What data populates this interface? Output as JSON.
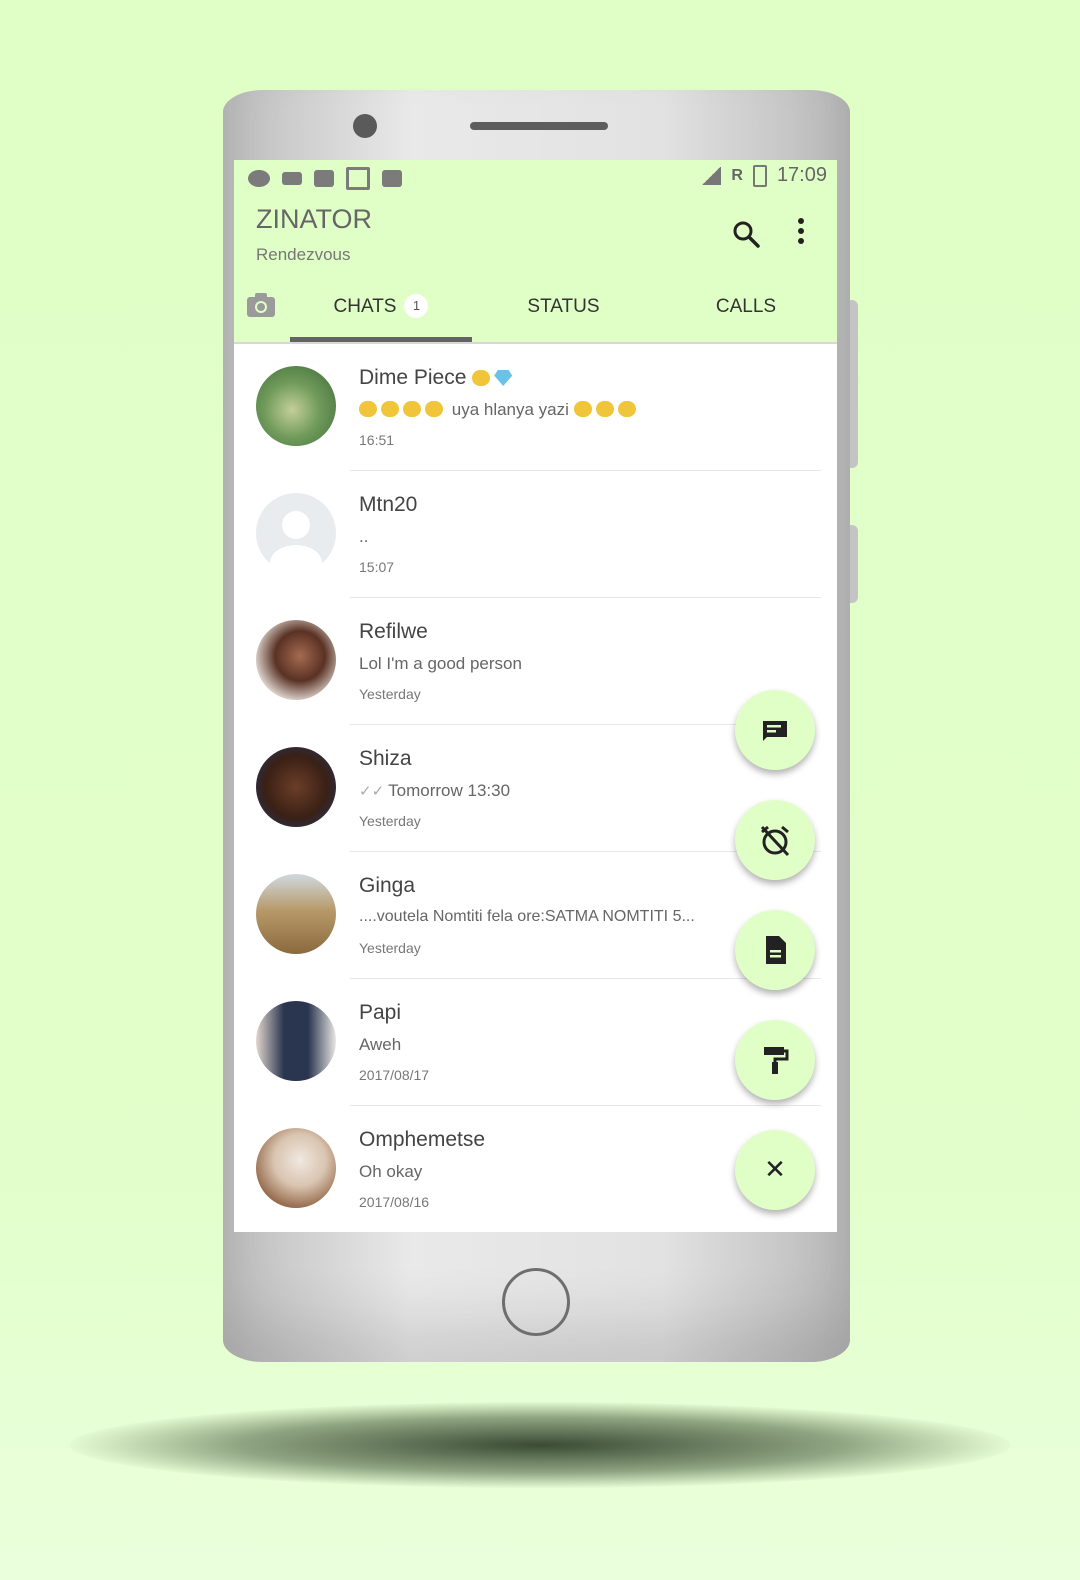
{
  "status_bar": {
    "time": "17:09",
    "carrier_letter": "R"
  },
  "header": {
    "title": "ZINATOR",
    "subtitle": "Rendezvous",
    "search_icon": "search-icon",
    "menu_icon": "more-vert-icon"
  },
  "tabs": [
    {
      "label": "CHATS",
      "badge": "1",
      "active": true
    },
    {
      "label": "STATUS"
    },
    {
      "label": "CALLS"
    }
  ],
  "chats": [
    {
      "name": "Dime Piece",
      "message": "uya hlanya yazi",
      "time": "16:51"
    },
    {
      "name": "Mtn20",
      "message": "..",
      "time": "15:07"
    },
    {
      "name": "Refilwe",
      "message": "Lol I'm a good person",
      "time": "Yesterday"
    },
    {
      "name": "Shiza",
      "message": "Tomorrow 13:30",
      "time": "Yesterday"
    },
    {
      "name": "Ginga",
      "message": "....voutela Nomtiti fela ore:SATMA NOMTITI  5...",
      "time": "Yesterday"
    },
    {
      "name": "Papi",
      "message": "Aweh",
      "time": "2017/08/17"
    },
    {
      "name": "Omphemetse",
      "message": "Oh okay",
      "time": "2017/08/16"
    }
  ],
  "fabs": [
    {
      "icon": "message-icon"
    },
    {
      "icon": "alarm-off-icon"
    },
    {
      "icon": "document-icon"
    },
    {
      "icon": "paint-roller-icon"
    },
    {
      "icon": "close-icon",
      "glyph": "✕"
    }
  ],
  "colors": {
    "accent": "#e0ffc6",
    "background": "#e0ffc6",
    "indicator": "#636363"
  }
}
